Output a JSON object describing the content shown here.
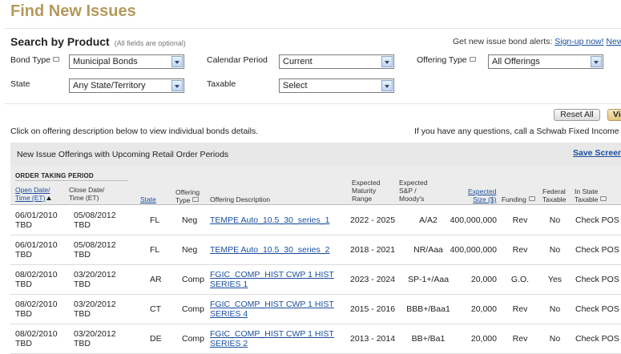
{
  "page_title": "Find New Issues",
  "search": {
    "heading": "Search by Product",
    "note": "(All fields are optional)",
    "alerts_text": "Get new issue bond alerts:",
    "alerts_link": "Sign-up now!",
    "alerts_new": "New"
  },
  "filters": {
    "bond_type": {
      "label": "Bond Type",
      "value": "Municipal Bonds"
    },
    "calendar_period": {
      "label": "Calendar Period",
      "value": "Current"
    },
    "offering_type": {
      "label": "Offering Type",
      "value": "All Offerings"
    },
    "state": {
      "label": "State",
      "value": "Any State/Territory"
    },
    "taxable": {
      "label": "Taxable",
      "value": "Select"
    }
  },
  "buttons": {
    "reset_all": "Reset All",
    "view": "Vi"
  },
  "click_note": "Click on offering description below to view individual bonds details.",
  "questions_note": "If you have any questions, call a Schwab Fixed Income Spe",
  "results": {
    "title": "New Issue Offerings with Upcoming Retail Order Periods",
    "save_link": "Save Screen"
  },
  "columns": {
    "order_taking_period": "ORDER TAKING PERIOD",
    "open_date_1": "Open Date/",
    "open_date_2": "Time (ET)",
    "close_date_1": "Close Date/",
    "close_date_2": "Time (ET)",
    "state": "State",
    "offering_type_1": "Offering",
    "offering_type_2": "Type",
    "offering_description": "Offering Description",
    "maturity_1": "Expected",
    "maturity_2": "Maturity",
    "maturity_3": "Range",
    "rating_1": "Expected",
    "rating_2": "S&P /",
    "rating_3": "Moody's",
    "size_1": "Expected",
    "size_2": "Size ($)",
    "funding": "Funding",
    "federal_1": "Federal",
    "federal_2": "Taxable",
    "instate_1": "In State",
    "instate_2": "Taxable"
  },
  "rows": [
    {
      "open_date": "06/01/2010",
      "open_time": "TBD",
      "close_date": "05/08/2012",
      "close_time": "TBD",
      "state": "FL",
      "offering_type": "Neg",
      "desc_1": "TEMPE Auto_10.5_30_series_1",
      "desc_2": "",
      "maturity": "2022 - 2025",
      "rating": "A/A2",
      "size": "400,000,000",
      "funding": "Rev",
      "federal_taxable": "No",
      "in_state": "Check POS"
    },
    {
      "open_date": "06/01/2010",
      "open_time": "TBD",
      "close_date": "05/08/2012",
      "close_time": "TBD",
      "state": "FL",
      "offering_type": "Neg",
      "desc_1": "TEMPE Auto_10.5_30_series_2",
      "desc_2": "",
      "maturity": "2018 - 2021",
      "rating": "NR/Aaa",
      "size": "400,000,000",
      "funding": "Rev",
      "federal_taxable": "No",
      "in_state": "Check POS"
    },
    {
      "open_date": "08/02/2010",
      "open_time": "TBD",
      "close_date": "03/20/2012",
      "close_time": "TBD",
      "state": "AR",
      "offering_type": "Comp",
      "desc_1": "FGIC_COMP_HIST CWP 1 HIST",
      "desc_2": "SERIES 1",
      "maturity": "2023 - 2024",
      "rating": "SP-1+/Aaa",
      "size": "20,000",
      "funding": "G.O.",
      "federal_taxable": "Yes",
      "in_state": "Check POS"
    },
    {
      "open_date": "08/02/2010",
      "open_time": "TBD",
      "close_date": "03/20/2012",
      "close_time": "TBD",
      "state": "CT",
      "offering_type": "Comp",
      "desc_1": "FGIC_COMP_HIST CWP 1 HIST",
      "desc_2": "SERIES 4",
      "maturity": "2015 - 2016",
      "rating": "BBB+/Baa1",
      "size": "20,000",
      "funding": "Rev",
      "federal_taxable": "No",
      "in_state": "Check POS"
    },
    {
      "open_date": "08/02/2010",
      "open_time": "TBD",
      "close_date": "03/20/2012",
      "close_time": "TBD",
      "state": "DE",
      "offering_type": "Comp",
      "desc_1": "FGIC_COMP_HIST CWP 1 HIST",
      "desc_2": "SERIES 2",
      "maturity": "2013 - 2014",
      "rating": "BB+/Ba1",
      "size": "20,000",
      "funding": "Rev",
      "federal_taxable": "No",
      "in_state": "Check POS"
    }
  ]
}
